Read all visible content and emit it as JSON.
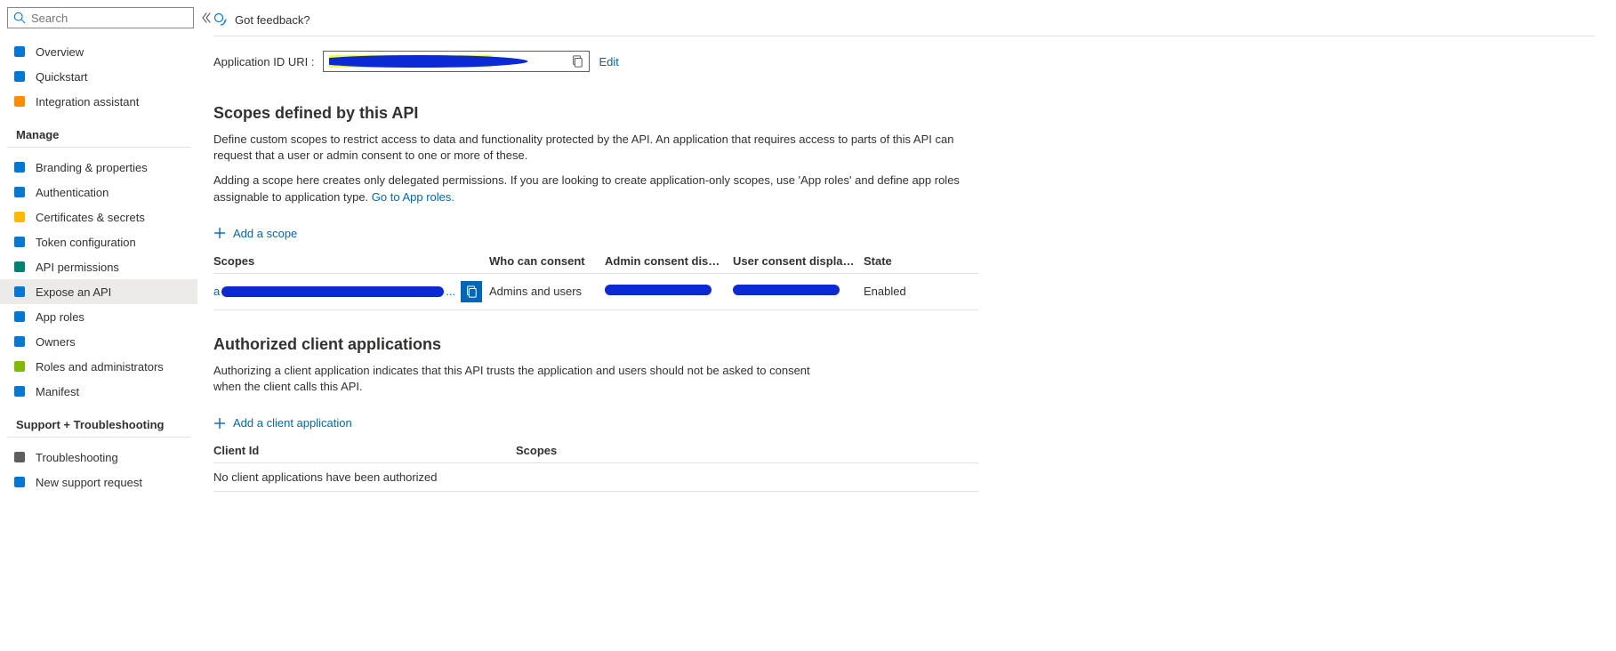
{
  "sidebar": {
    "search_placeholder": "Search",
    "top": [
      {
        "label": "Overview",
        "icon_color": "#0078d4"
      },
      {
        "label": "Quickstart",
        "icon_color": "#0078d4"
      },
      {
        "label": "Integration assistant",
        "icon_color": "#ff8c00"
      }
    ],
    "manage_heading": "Manage",
    "manage": [
      {
        "label": "Branding & properties",
        "icon_color": "#0078d4"
      },
      {
        "label": "Authentication",
        "icon_color": "#0078d4"
      },
      {
        "label": "Certificates & secrets",
        "icon_color": "#ffb900"
      },
      {
        "label": "Token configuration",
        "icon_color": "#0078d4"
      },
      {
        "label": "API permissions",
        "icon_color": "#008272"
      },
      {
        "label": "Expose an API",
        "icon_color": "#0078d4",
        "selected": true
      },
      {
        "label": "App roles",
        "icon_color": "#0078d4"
      },
      {
        "label": "Owners",
        "icon_color": "#0078d4"
      },
      {
        "label": "Roles and administrators",
        "icon_color": "#7fba00"
      },
      {
        "label": "Manifest",
        "icon_color": "#0078d4"
      }
    ],
    "support_heading": "Support + Troubleshooting",
    "support": [
      {
        "label": "Troubleshooting",
        "icon_color": "#605e5c"
      },
      {
        "label": "New support request",
        "icon_color": "#0078d4"
      }
    ]
  },
  "header": {
    "feedback_label": "Got feedback?"
  },
  "app_id": {
    "label": "Application ID URI :",
    "edit": "Edit"
  },
  "scopes": {
    "title": "Scopes defined by this API",
    "desc1": "Define custom scopes to restrict access to data and functionality protected by the API. An application that requires access to parts of this API can request that a user or admin consent to one or more of these.",
    "desc2a": "Adding a scope here creates only delegated permissions. If you are looking to create application-only scopes, use 'App roles' and define app roles assignable to application type. ",
    "desc2_link": "Go to App roles.",
    "add_scope": "Add a scope",
    "cols": {
      "scopes": "Scopes",
      "who": "Who can consent",
      "admin": "Admin consent display ...",
      "user": "User consent display na...",
      "state": "State"
    },
    "rows": [
      {
        "who": "Admins and users",
        "state": "Enabled"
      }
    ]
  },
  "clients": {
    "title": "Authorized client applications",
    "desc": "Authorizing a client application indicates that this API trusts the application and users should not be asked to consent when the client calls this API.",
    "add_client": "Add a client application",
    "cols": {
      "clientid": "Client Id",
      "scopes": "Scopes"
    },
    "empty": "No client applications have been authorized"
  }
}
